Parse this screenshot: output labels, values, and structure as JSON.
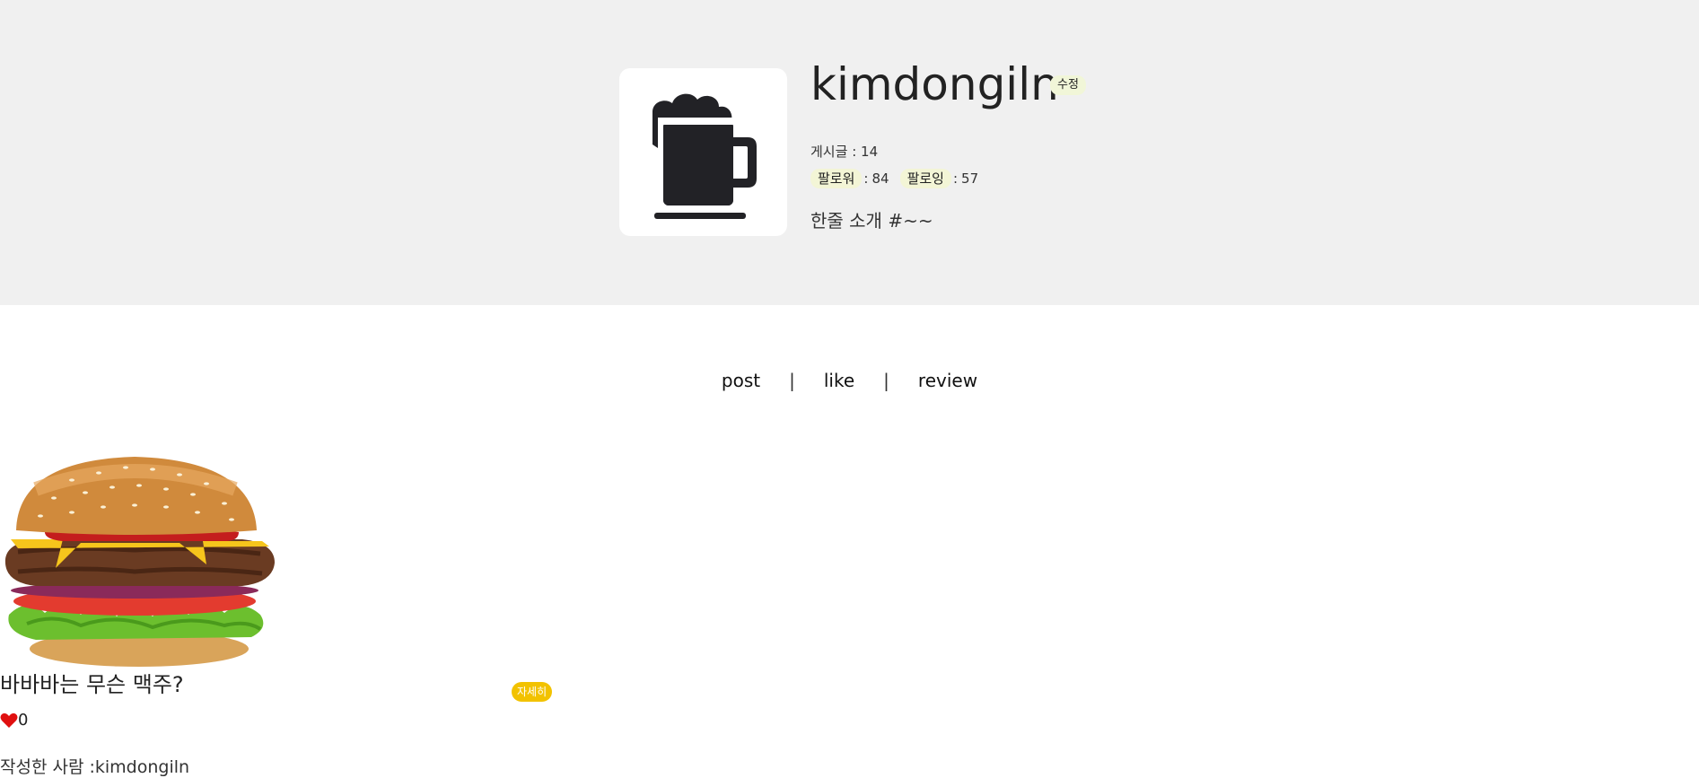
{
  "profile": {
    "username": "kimdongiln",
    "edit_label": "수정",
    "posts_label": "게시글",
    "posts_count": "14",
    "followers_label": "팔로워",
    "followers_count": "84",
    "following_label": "팔로잉",
    "following_count": "57",
    "bio": "한줄 소개 #~~",
    "avatar_icon": "beer-mug-icon"
  },
  "tabs": [
    {
      "label": "post"
    },
    {
      "label": "like"
    },
    {
      "label": "review"
    }
  ],
  "tab_divider": "|",
  "stat_separator": ":",
  "posts": [
    {
      "image_icon": "hamburger-image",
      "title": "바바바는 무슨 맥주?",
      "detail_label": "자세히",
      "like_count": "0",
      "author_prefix": "작성한 사람 :",
      "author": "kimdongiln"
    }
  ],
  "colors": {
    "header_bg": "#f0f0f0",
    "detail_button": "#f2c200",
    "heart": "#e01010",
    "chip_bg": "#f3f5d6"
  }
}
